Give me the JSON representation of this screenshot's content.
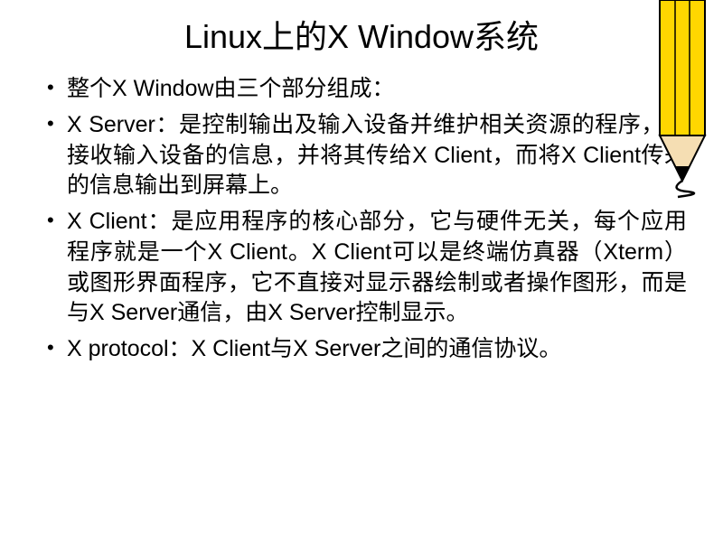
{
  "title": "Linux上的X Window系统",
  "bullets": [
    "整个X Window由三个部分组成：",
    "X Server：是控制输出及输入设备并维护相关资源的程序，它接收输入设备的信息，并将其传给X Client，而将X Client传来的信息输出到屏幕上。",
    "X Client：是应用程序的核心部分，它与硬件无关，每个应用程序就是一个X Client。X Client可以是终端仿真器（Xterm）或图形界面程序，它不直接对显示器绘制或者操作图形，而是与X Server通信，由X Server控制显示。",
    "X protocol：X Client与X Server之间的通信协议。"
  ]
}
